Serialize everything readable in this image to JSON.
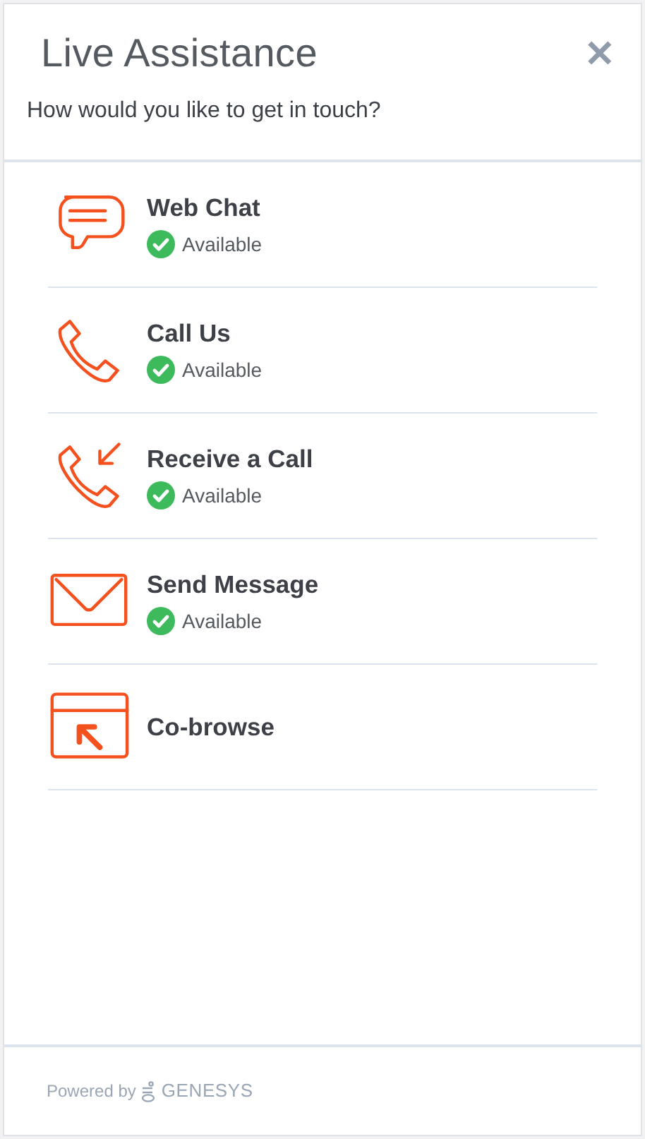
{
  "header": {
    "title": "Live Assistance",
    "close": "✕",
    "subtitle": "How would you like to get in touch?"
  },
  "options": [
    {
      "kind": "chat",
      "label": "Web Chat",
      "available": true,
      "status": "Available"
    },
    {
      "kind": "phone",
      "label": "Call Us",
      "available": true,
      "status": "Available"
    },
    {
      "kind": "callback",
      "label": "Receive a Call",
      "available": true,
      "status": "Available"
    },
    {
      "kind": "message",
      "label": "Send Message",
      "available": true,
      "status": "Available"
    },
    {
      "kind": "cobrowse",
      "label": "Co-browse",
      "available": false
    }
  ],
  "footer": {
    "label": "Powered by",
    "brand": "GENESYS"
  }
}
